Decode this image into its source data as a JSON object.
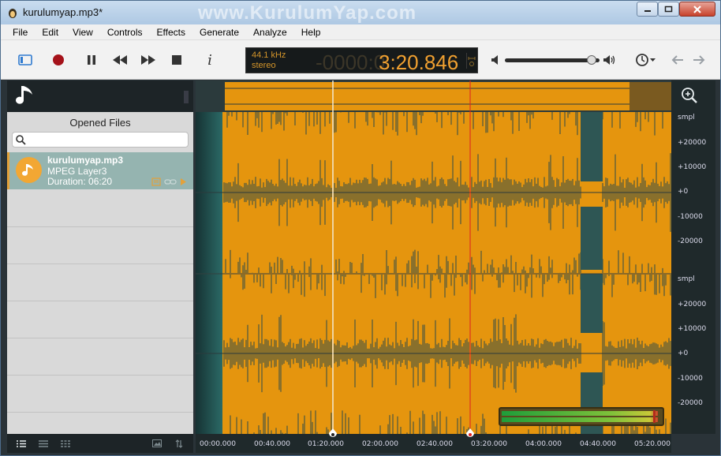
{
  "window": {
    "title": "kurulumyap.mp3*",
    "watermark": "www.KurulumYap.com"
  },
  "menu": [
    "File",
    "Edit",
    "View",
    "Controls",
    "Effects",
    "Generate",
    "Analyze",
    "Help"
  ],
  "toolbar": {
    "info_label": "i",
    "sample_rate": "44.1 kHz",
    "channels": "stereo",
    "time_inactive": "-0000:0",
    "time": "3:20.846",
    "volume_level": 0.96
  },
  "files_panel": {
    "title": "Opened Files",
    "search_placeholder": "",
    "files": [
      {
        "name": "kurulumyap.mp3",
        "format": "MPEG Layer3",
        "duration": "Duration: 06:20"
      }
    ]
  },
  "amplitude_labels": [
    "smpl",
    "+20000",
    "+10000",
    "+0",
    "-10000",
    "-20000",
    "smpl",
    "+20000",
    "+10000",
    "+0",
    "-10000",
    "-20000"
  ],
  "time_labels": [
    "00:00.000",
    "00:40.000",
    "01:20.000",
    "02:00.000",
    "02:40.000",
    "03:20.000",
    "04:00.000",
    "04:40.000",
    "05:20.000"
  ],
  "colors": {
    "waveform": "#e5950e",
    "background": "#1f292b",
    "accent": "#f0a030",
    "playhead": "#e02020"
  },
  "markers": {
    "cursor_time": "01:20.000",
    "playhead_time": "03:20.846"
  }
}
